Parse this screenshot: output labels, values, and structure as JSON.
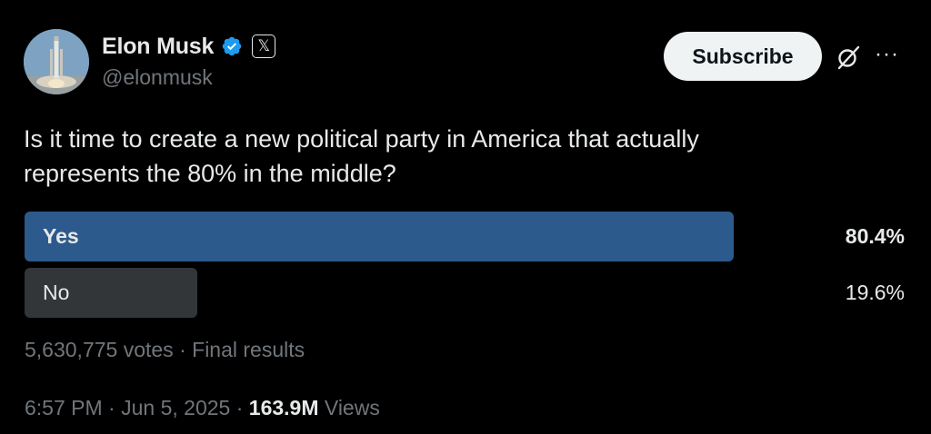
{
  "author": {
    "display_name": "Elon Musk",
    "handle": "@elonmusk",
    "verified": true,
    "badge_icon": "x-logo-icon",
    "avatar_icon": "rocket-launch-avatar"
  },
  "actions": {
    "subscribe_label": "Subscribe",
    "grok_icon": "grok-icon",
    "more_icon": "more-options-icon",
    "more_glyph": "···"
  },
  "tweet": {
    "text_line1": "Is it time to create a new political party in America that actually",
    "text_line2": "represents the 80% in the middle?"
  },
  "poll": {
    "options": [
      {
        "label": "Yes",
        "percent_label": "80.4%",
        "percent": 80.4,
        "winner": true
      },
      {
        "label": "No",
        "percent_label": "19.6%",
        "percent": 19.6,
        "winner": false
      }
    ],
    "votes": "5,630,775 votes",
    "status": "Final results",
    "separator": "·"
  },
  "meta": {
    "time": "6:57 PM",
    "date": "Jun 5, 2025",
    "views_count": "163.9M",
    "views_label": "Views",
    "separator": "·"
  },
  "colors": {
    "background": "#000000",
    "winner_bar": "#2c5a8c",
    "loser_bar": "#333639",
    "verified_blue": "#1d9bf0",
    "secondary_text": "#71767b",
    "primary_text": "#e7e9ea",
    "subscribe_bg": "#eff3f4"
  }
}
